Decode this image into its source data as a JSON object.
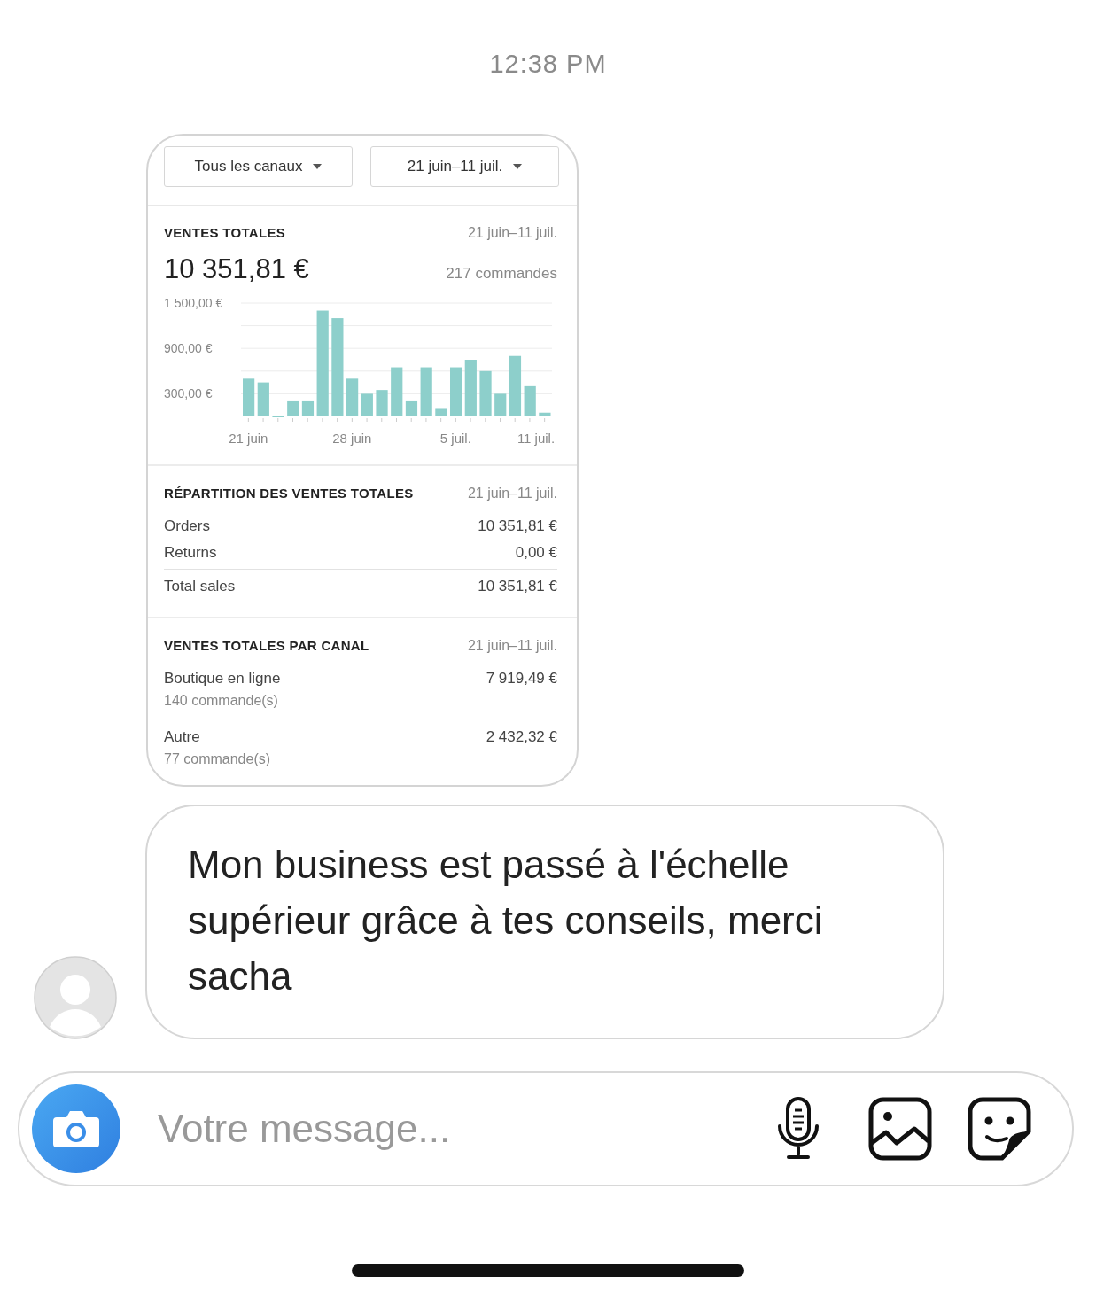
{
  "timestamp": "12:38 PM",
  "shared_screenshot": {
    "filters": [
      {
        "label": "Tous les canaux"
      },
      {
        "label": "21 juin–11 juil."
      }
    ],
    "total_sales": {
      "title": "VENTES TOTALES",
      "date_range": "21 juin–11 juil.",
      "amount": "10 351,81 €",
      "orders": "217 commandes",
      "chart_data": {
        "type": "bar",
        "categories": [
          "21 juin",
          null,
          null,
          null,
          null,
          null,
          null,
          "28 juin",
          null,
          null,
          null,
          null,
          null,
          null,
          "5 juil.",
          null,
          null,
          null,
          null,
          null,
          "11 juil."
        ],
        "series": [
          {
            "color": "#8dcfcb",
            "values": [
              500,
              450,
              0,
              200,
              200,
              1400,
              1300,
              500,
              300,
              350,
              650,
              200,
              650,
              100,
              650,
              750,
              600,
              300,
              800,
              400,
              50
            ]
          }
        ],
        "ylim": [
          0,
          1500
        ],
        "yticks": [
          {
            "value": 300,
            "label": "300,00 €"
          },
          {
            "value": 900,
            "label": "900,00 €"
          },
          {
            "value": 1500,
            "label": "1 500,00 €"
          }
        ]
      }
    },
    "breakdown": {
      "title": "RÉPARTITION DES VENTES TOTALES",
      "date_range": "21 juin–11 juil.",
      "rows": [
        {
          "kind": "line",
          "label": "Orders",
          "value": "10 351,81 €"
        },
        {
          "kind": "line",
          "label": "Returns",
          "value": "0,00 €"
        },
        {
          "kind": "total",
          "label": "Total sales",
          "value": "10 351,81 €"
        }
      ]
    },
    "by_channel": {
      "title": "VENTES TOTALES PAR CANAL",
      "date_range": "21 juin–11 juil.",
      "channels": [
        {
          "name": "Boutique en ligne",
          "orders": "140 commande(s)",
          "amount": "7 919,49 €"
        },
        {
          "name": "Autre",
          "orders": "77 commande(s)",
          "amount": "2 432,32 €"
        }
      ]
    }
  },
  "message": {
    "text": "Mon business est passé à l'échelle supérieur grâce à tes conseils, merci sacha"
  },
  "composer": {
    "placeholder": "Votre message..."
  }
}
